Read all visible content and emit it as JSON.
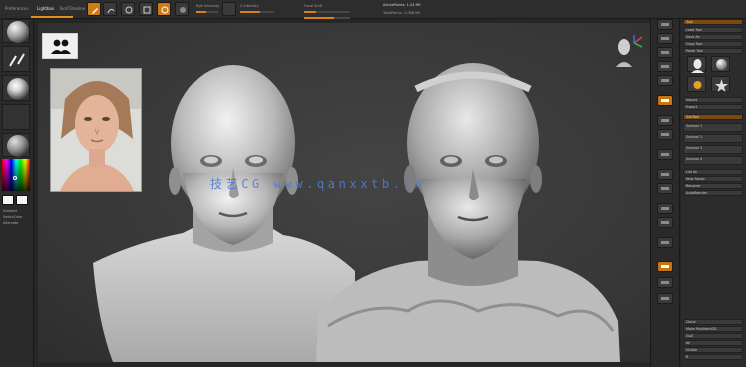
{
  "menu": {
    "tabs": [
      "Preferences",
      "Lightbox",
      "Tool/Timeline"
    ],
    "active_tab": "Lightbox"
  },
  "toolbar": {
    "brush_slider_label": "Z Intensity",
    "draw_slider_label": "Draw Size",
    "rgb_label": "Rgb Intensity",
    "focal_label": "Focal Shift",
    "info_label_1": "ActivePoints: 1.04 Mil",
    "info_label_2": "TotalPoints: 2.088 Mil"
  },
  "left_panel": {
    "labels": [
      "Gradient",
      "SwitchColor",
      "Alternate"
    ]
  },
  "viewport": {
    "watermark": "技艺CG www.qanxxtb.cn"
  },
  "palette": {
    "header": "Tool",
    "rows": [
      "Load Tool",
      "Save As",
      "Copy Tool",
      "Paste Tool",
      "Import",
      "Export",
      "Clone",
      "Make PolyMesh3D",
      "GoZ",
      "All",
      "Visible",
      "R"
    ],
    "subtool_title": "SubTool",
    "subtool_rows": [
      "Subtool 1",
      "Subtool 2",
      "Subtool 3",
      "Subtool 4"
    ],
    "footer_rows": [
      "List All",
      "New Folder",
      "Rename",
      "AutoReorder"
    ]
  },
  "colors": {
    "accent": "#e48f1c",
    "watermark": "#4a7ddb",
    "viewport_bg": "#3b3b3b"
  }
}
